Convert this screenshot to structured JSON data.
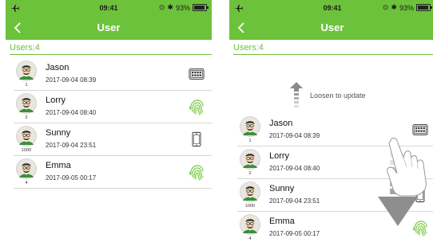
{
  "left_screen": {
    "status": {
      "time": "09:41",
      "battery": "93%",
      "battery_level": 0.93
    },
    "nav": {
      "title": "User"
    },
    "users_label": "Users:4",
    "users": [
      {
        "id": "1",
        "name": "Jason",
        "date": "2017-09-04 08:39",
        "method_icon": "keypad-icon"
      },
      {
        "id": "2",
        "name": "Lorry",
        "date": "2017-09-04 08:40",
        "method_icon": "fingerprint-icon"
      },
      {
        "id": "1000",
        "name": "Sunny",
        "date": "2017-09-04 23:51",
        "method_icon": "phone-icon"
      },
      {
        "id": "4",
        "name": "Emma",
        "date": "2017-09-05 00:17",
        "method_icon": "fingerprint-icon"
      }
    ]
  },
  "right_screen": {
    "status": {
      "time": "09:41",
      "battery": "93%",
      "battery_level": 0.93
    },
    "nav": {
      "title": "User"
    },
    "users_label": "Users:4",
    "pull_hint": "Loosen to update",
    "users": [
      {
        "id": "1",
        "name": "Jason",
        "date": "2017-09-04 08:39",
        "method_icon": "keypad-icon"
      },
      {
        "id": "2",
        "name": "Lorry",
        "date": "2017-09-04 08:40",
        "method_icon": "none"
      },
      {
        "id": "1000",
        "name": "Sunny",
        "date": "2017-09-04 23:51",
        "method_icon": "phone-icon"
      },
      {
        "id": "4",
        "name": "Emma",
        "date": "2017-09-05 00:17",
        "method_icon": "fingerprint-icon"
      }
    ]
  },
  "colors": {
    "accent": "#6dc23b",
    "fingerprint": "#7cc94a",
    "text": "#111111",
    "divider": "#d6d6d6"
  }
}
